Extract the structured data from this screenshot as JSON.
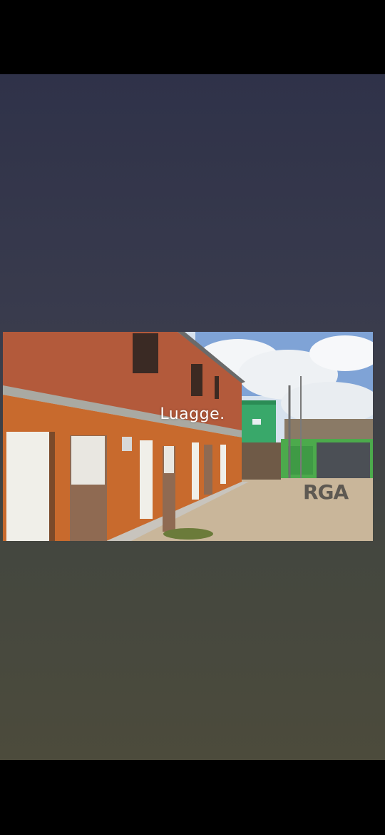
{
  "photo": {
    "watermark_primary": "Luagge.",
    "watermark_secondary": "RGA",
    "description_icon": "building-photo"
  },
  "colors": {
    "background_top": "#2f3249",
    "background_bottom": "#4c4b3c",
    "brick": "#b95a3a",
    "orange_wall": "#c8622a",
    "green_wall": "#2fa35a"
  }
}
